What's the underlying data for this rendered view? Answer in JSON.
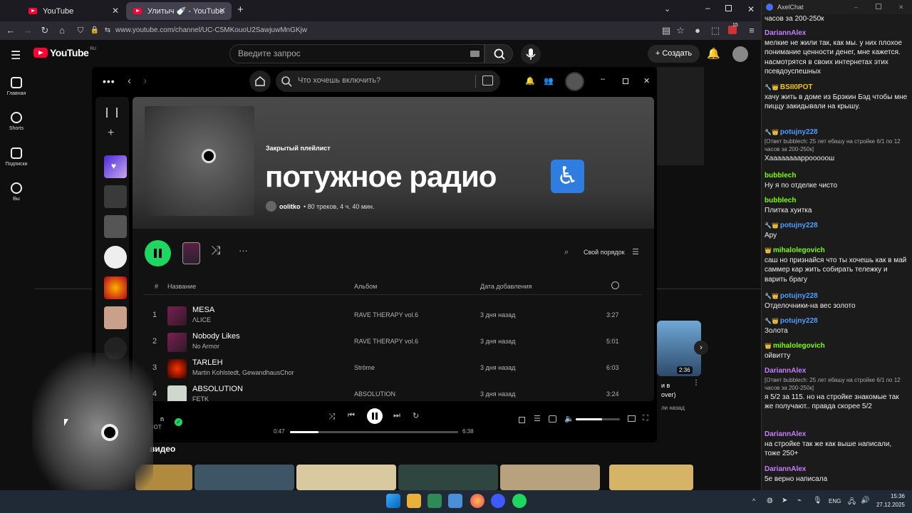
{
  "browser": {
    "tabs": [
      {
        "label": "YouTube",
        "active": false
      },
      {
        "label": "Улитыч 🍼 - YouTube",
        "active": true
      }
    ],
    "new_tab": "+",
    "url": "www.youtube.com/channel/UC-C5MKouoU2SawjuwMnGKjw",
    "badge_count": "15"
  },
  "youtube": {
    "logo_text": "YouTube",
    "logo_region": "RU",
    "search_placeholder": "Введите запрос",
    "create_label": "+ Создать",
    "sidebar": [
      {
        "label": "Главная",
        "icon": "home-icon"
      },
      {
        "label": "Shorts",
        "icon": "shorts-icon"
      },
      {
        "label": "Подписки",
        "icon": "subscriptions-icon"
      },
      {
        "label": "Вы",
        "icon": "user-icon"
      }
    ],
    "section_title": "е видео",
    "side_card": {
      "duration": "2:36",
      "title_fragment": "и в",
      "title_fragment2": "over)",
      "meta": "ли назад"
    }
  },
  "spotify": {
    "search_placeholder": "Что хочешь включить?",
    "playlist": {
      "kind": "Закрытый плейлист",
      "title": "потужное радио",
      "emoji": "♿",
      "owner": "oolitko",
      "stats": "• 80 треков, 4 ч. 40 мин."
    },
    "sort_label": "Свой порядок",
    "columns": {
      "num": "#",
      "title": "Название",
      "album": "Альбом",
      "date": "Дата добавления"
    },
    "tracks": [
      {
        "num": "1",
        "title": "MESA",
        "artist": "ΛLICE",
        "album": "RAVE THERAPY vol.6",
        "date": "3 дня назад",
        "duration": "3:27"
      },
      {
        "num": "2",
        "title": "Nobody Likes",
        "artist": "No Armor",
        "album": "RAVE THERAPY vol.6",
        "date": "3 дня назад",
        "duration": "5:01"
      },
      {
        "num": "3",
        "title": "TARLEH",
        "artist": "Martin Kohlstedt, GewandhausChor",
        "album": "Ströme",
        "date": "3 дня назад",
        "duration": "6:03"
      },
      {
        "num": "4",
        "title": "ABSOLUTION",
        "artist": "FETK",
        "album": "ABSOLUTION",
        "date": "3 дня назад",
        "duration": "3:24"
      }
    ],
    "player": {
      "now_title_fragment": "n",
      "now_artist_fragment": "RNOT",
      "elapsed": "0:47",
      "total": "6:38",
      "progress": 0.17,
      "volume": 0.6
    }
  },
  "chat": {
    "app_title": "AxelChat",
    "messages": [
      {
        "author": "",
        "text": "часов за 200-250к",
        "color": "#eeeeee"
      },
      {
        "author": "DariannAlex",
        "text": "мелкие не жили так, как мы. у них плохое понимание ценности денег, мне кажется. насмотрятся в своих интернетах этих псевдоуспешных",
        "color": "#c77dff"
      },
      {
        "author": "BSII0POT",
        "text": "хачу жить в доме из Брэкин Бэд чтобы мне пиццу закидывали на крышу.",
        "color": "#f5c518",
        "badges": "🔧👑"
      },
      {
        "author": "potujny228",
        "reply": "[Ответ bubblech: 25 лет ебашу на стройке 6/1 по 12 часов за 200-250к]",
        "text": "Хааааааааррооооош",
        "color": "#4f9dff",
        "badges": "🔧👑"
      },
      {
        "author": "bubblech",
        "text": "Ну я по отделке чисто",
        "color": "#7cfc00"
      },
      {
        "author": "bubblech",
        "text": "Плитка хуитка",
        "color": "#7cfc00"
      },
      {
        "author": "potujny228",
        "text": "Ару",
        "color": "#4f9dff",
        "badges": "🔧👑"
      },
      {
        "author": "mihalolegovich",
        "text": "саш но признайся что ты хочешь как в май саммер кар жить собирать тележку и варить брагу",
        "color": "#7cfc00",
        "badges": "👑"
      },
      {
        "author": "potujny228",
        "text": "Отделочники-на вес золото",
        "color": "#4f9dff",
        "badges": "🔧👑"
      },
      {
        "author": "potujny228",
        "text": "Золота",
        "color": "#4f9dff",
        "badges": "🔧👑"
      },
      {
        "author": "mihalolegovich",
        "text": "ойвитту",
        "color": "#7cfc00",
        "badges": "👑"
      },
      {
        "author": "DariannAlex",
        "reply": "[Ответ bubblech: 25 лет ебашу на стройке 6/1 по 12 часов за 200-250к]",
        "text": "я 5/2 за 115. но на стройке знакомые так же получают.. правда скорее 5/2",
        "color": "#c77dff"
      },
      {
        "author": "DariannAlex",
        "text": "на стройке так же как выше написали, тоже 250+",
        "color": "#c77dff"
      },
      {
        "author": "DariannAlex",
        "text": "5е верно написала",
        "color": "#c77dff"
      }
    ]
  },
  "taskbar": {
    "lang": "ENG",
    "time": "15:36",
    "date": "27.12.2025"
  }
}
